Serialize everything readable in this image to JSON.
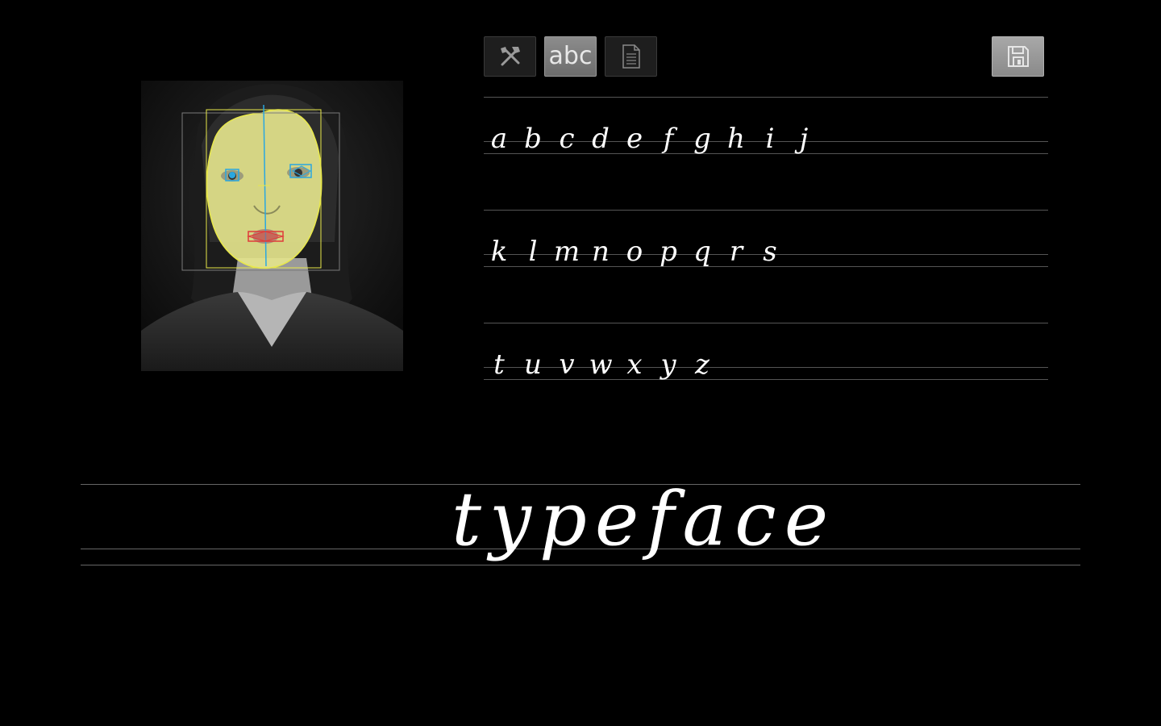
{
  "toolbar": {
    "tools_icon": "tools-icon",
    "abc_label": "abc",
    "document_icon": "document-icon",
    "save_icon": "save-icon",
    "active_tab": "abc"
  },
  "face_analysis": {
    "face_outline_color": "#e8e84a",
    "face_fill_color": "#e4e48c",
    "eye_marker_color": "#2aa7e0",
    "mouth_marker_color": "#e03a3a",
    "bounds_color": "#7a7a7a",
    "axis_color": "#2aa7e0"
  },
  "alphabet": {
    "row1": [
      "a",
      "b",
      "c",
      "d",
      "e",
      "f",
      "g",
      "h",
      "i",
      "j"
    ],
    "row2": [
      "k",
      "l",
      "m",
      "n",
      "o",
      "p",
      "q",
      "r",
      "s"
    ],
    "row3": [
      "t",
      "u",
      "v",
      "w",
      "x",
      "y",
      "z"
    ]
  },
  "sample": {
    "word": "typeface"
  }
}
